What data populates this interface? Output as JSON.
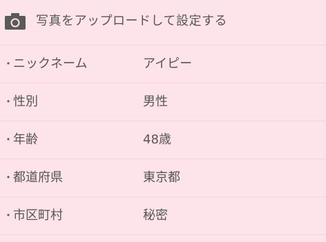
{
  "upload": {
    "icon": "camera-icon",
    "label": "写真をアップロードして設定する"
  },
  "profile": {
    "bullet": "・",
    "rows": [
      {
        "label": "ニックネーム",
        "value": "アイピー"
      },
      {
        "label": "性別",
        "value": "男性"
      },
      {
        "label": "年齢",
        "value": "48歳"
      },
      {
        "label": "都道府県",
        "value": "東京都"
      },
      {
        "label": "市区町村",
        "value": "秘密"
      }
    ]
  },
  "colors": {
    "background": "#fde4ea",
    "divider": "#f6d2dc",
    "text": "#555555",
    "icon": "#5a5a5a"
  }
}
